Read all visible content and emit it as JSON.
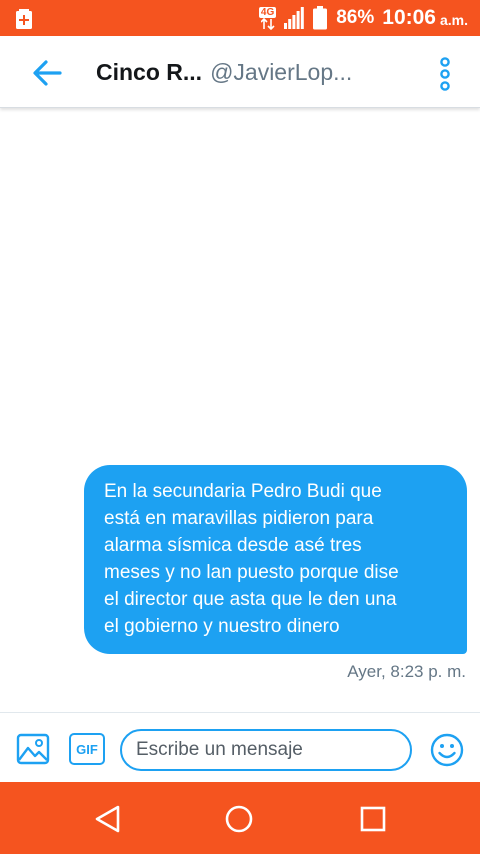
{
  "status_bar": {
    "network": "4G",
    "battery": "86%",
    "time": "10:06",
    "ampm": "a.m."
  },
  "header": {
    "name": "Cinco R...",
    "handle": "@JavierLop..."
  },
  "conversation": {
    "messages": [
      {
        "direction": "sent",
        "lines": [
          "En la secundaria Pedro Budi que",
          "está en maravillas pidieron para",
          "alarma sísmica desde asé tres",
          "meses y no lan puesto porque dise",
          "el director que asta que le den una",
          "el gobierno y nuestro dinero"
        ],
        "timestamp": "Ayer, 8:23 p. m."
      }
    ]
  },
  "composer": {
    "gif_label": "GIF",
    "placeholder": "Escribe un mensaje",
    "value": ""
  },
  "icons": {
    "battery_charging": "battery-charging-icon",
    "signal": "signal-icon",
    "battery": "battery-icon",
    "back": "arrow-left-icon",
    "more": "more-vertical-icon",
    "image": "image-icon",
    "emoji": "emoji-icon",
    "nav_back": "triangle-back-icon",
    "nav_home": "circle-home-icon",
    "nav_recent": "square-recents-icon"
  },
  "colors": {
    "system_bars": "#f5541f",
    "accent": "#1da1f2",
    "bubble_text": "#ffffff",
    "secondary_text": "#657786"
  }
}
